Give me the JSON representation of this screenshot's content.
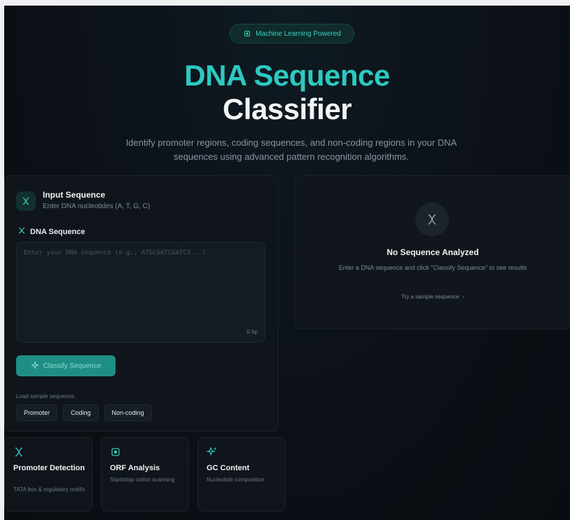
{
  "badge": {
    "icon": "cpu-icon",
    "label": "Machine Learning Powered"
  },
  "hero": {
    "title_line1": "DNA Sequence",
    "title_line2": "Classifier",
    "subtitle": "Identify promoter regions, coding sequences, and non-coding regions in your DNA sequences using advanced pattern recognition algorithms."
  },
  "input_panel": {
    "icon": "dna-icon",
    "title": "Input Sequence",
    "subtitle": "Enter DNA nucleotides (A, T, G, C)",
    "field_label": "DNA Sequence",
    "placeholder": "Enter your DNA sequence (e.g., ATGCGATCGATCG...)",
    "value": "",
    "bp_count": "0 bp",
    "classify_label": "Classify Sequence",
    "load_label": "Load sample sequence:",
    "samples": [
      "Promoter",
      "Coding",
      "Non-coding"
    ]
  },
  "result_panel": {
    "icon": "dna-icon",
    "title": "No Sequence Analyzed",
    "description": "Enter a DNA sequence and click \"Classify Sequence\" to see results",
    "try_link": "Try a sample sequence",
    "try_icon": "chevron-right-icon"
  },
  "features": [
    {
      "icon": "dna-icon",
      "title": "Promoter Detection",
      "description": "TATA box & regulatory motifs"
    },
    {
      "icon": "cpu-icon",
      "title": "ORF Analysis",
      "description": "Start/stop codon scanning"
    },
    {
      "icon": "sparkles-icon",
      "title": "GC Content",
      "description": "Nucleotide composition"
    }
  ],
  "colors": {
    "accent": "#2cc9c0",
    "background": "#0b1016",
    "panel": "#0f151b",
    "button": "#1f8f86"
  }
}
